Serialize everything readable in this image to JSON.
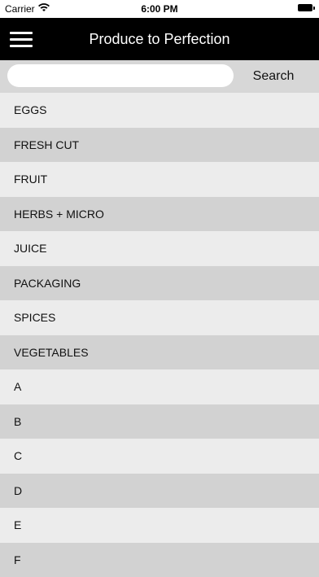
{
  "status": {
    "carrier": "Carrier",
    "time": "6:00 PM"
  },
  "header": {
    "title": "Produce to Perfection"
  },
  "search": {
    "placeholder": "",
    "value": "",
    "button_label": "Search"
  },
  "list": {
    "items": [
      "EGGS",
      "FRESH CUT",
      "FRUIT",
      "HERBS + MICRO",
      "JUICE",
      "PACKAGING",
      "SPICES",
      "VEGETABLES",
      "A",
      "B",
      "C",
      "D",
      "E",
      "F"
    ]
  }
}
